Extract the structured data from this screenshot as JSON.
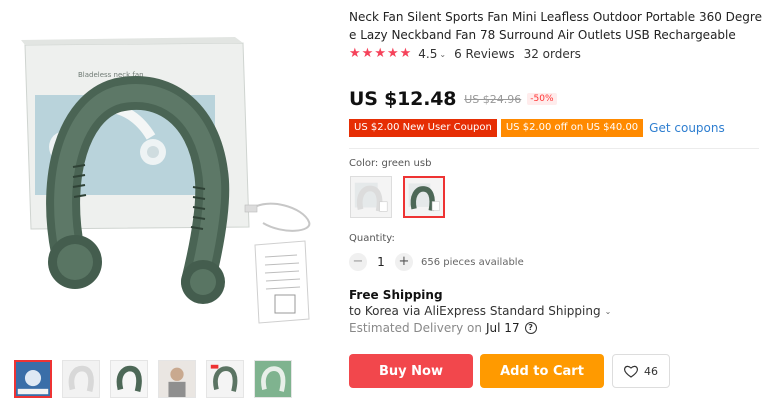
{
  "product": {
    "title": "Neck Fan Silent Sports Fan Mini Leafless Outdoor Portable 360 Degree Lazy Neckband Fan 78 Surround Air Outlets USB Rechargeable",
    "box_label": "Bladeless neck fan"
  },
  "rating": {
    "stars": 5,
    "value": "4.5",
    "reviews": "6 Reviews",
    "orders": "32 orders"
  },
  "price": {
    "current": "US $12.48",
    "original": "US $24.96",
    "discount": "-50%"
  },
  "coupons": {
    "new_user": "US $2.00 New User Coupon",
    "off": "US $2.00 off on US $40.00",
    "get": "Get coupons"
  },
  "color": {
    "label": "Color: green usb",
    "options": [
      "white usb",
      "green usb"
    ],
    "selected": "green usb"
  },
  "quantity": {
    "label": "Quantity:",
    "value": "1",
    "minus": "−",
    "plus": "+",
    "available": "656 pieces available"
  },
  "shipping": {
    "title": "Free Shipping",
    "to": "to Korea via AliExpress Standard Shipping",
    "estimated_label": "Estimated Delivery on",
    "date": "Jul 17"
  },
  "actions": {
    "buy": "Buy Now",
    "cart": "Add to Cart",
    "wish_count": "46"
  },
  "colors": {
    "star": "#f5425a",
    "buy": "#f2474c",
    "cart": "#ff9a00",
    "coupon_red": "#e62e04",
    "coupon_orange": "#ff8a00",
    "link": "#2e7ed0"
  },
  "icons": {
    "caret": "chevron-down-icon",
    "info": "question-circle-icon",
    "wish": "heart-icon"
  }
}
